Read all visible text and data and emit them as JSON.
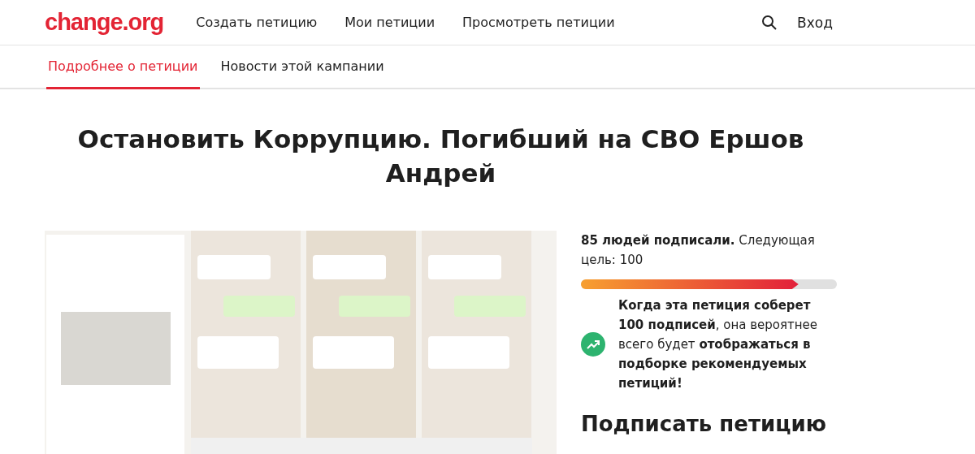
{
  "header": {
    "logo": "change.org",
    "nav": [
      "Создать петицию",
      "Мои петиции",
      "Просмотреть петиции"
    ],
    "login": "Вход"
  },
  "tabs": [
    {
      "label": "Подробнее о петиции",
      "selected": true
    },
    {
      "label": "Новости этой кампании",
      "selected": false
    }
  ],
  "title": "Остановить Коррупцию. Погибший на СВО Ершов Андрей",
  "progress": {
    "summary": "**85 людей подписали.** Следующая цель: 100",
    "level": 0.85,
    "tip": "**Когда эта петиция соберет 100 подписей**, она вероятнее всего будет **отображаться в подборке рекомендуемых петиций!**"
  },
  "sign_heading": "Подписать петицию"
}
